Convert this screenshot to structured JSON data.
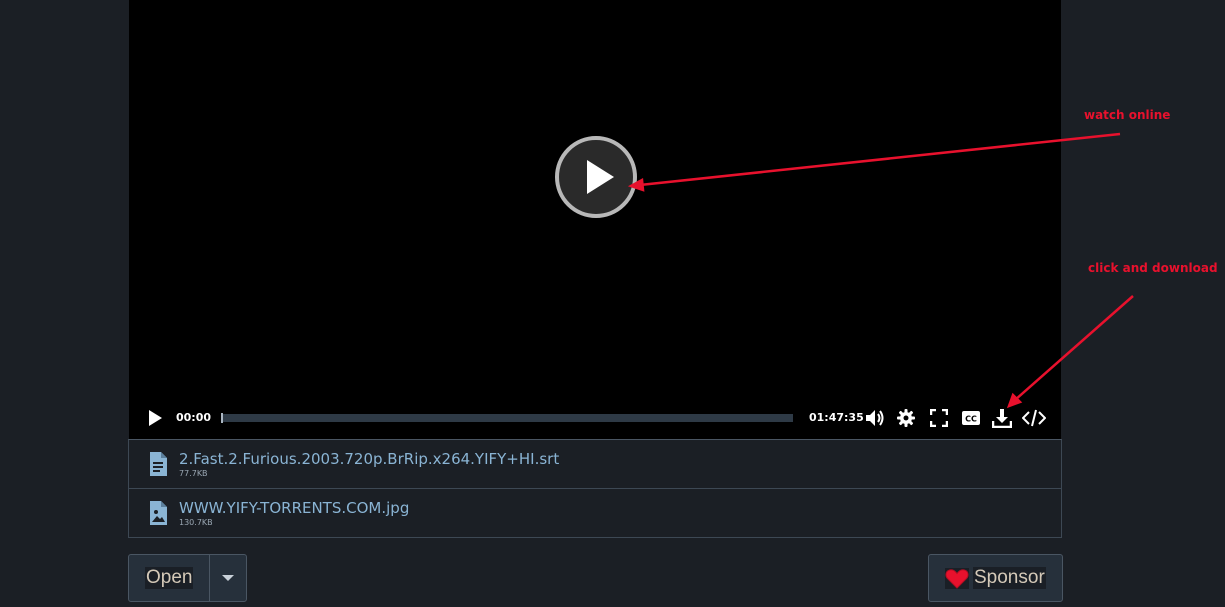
{
  "player": {
    "time_current": "00:00",
    "time_total": "01:47:35",
    "progress": 0,
    "controls": [
      "play-icon",
      "volume-icon",
      "gear-icon",
      "fullscreen-icon",
      "cc-icon",
      "download-icon",
      "embed-code-icon"
    ]
  },
  "annotations": {
    "watch_online": "watch online",
    "click_download": "click and download"
  },
  "files": [
    {
      "name": "2.Fast.2.Furious.2003.720p.BrRip.x264.YIFY+HI.srt",
      "size": "77.7KB",
      "icon": "document-icon"
    },
    {
      "name": "WWW.YIFY-TORRENTS.COM.jpg",
      "size": "130.7KB",
      "icon": "image-file-icon"
    }
  ],
  "buttons": {
    "open_label": "Open",
    "sponsor_label": "Sponsor"
  },
  "colors": {
    "background": "#1b1f25",
    "annotation": "#e8112d",
    "file_link": "#8ab4d4"
  }
}
